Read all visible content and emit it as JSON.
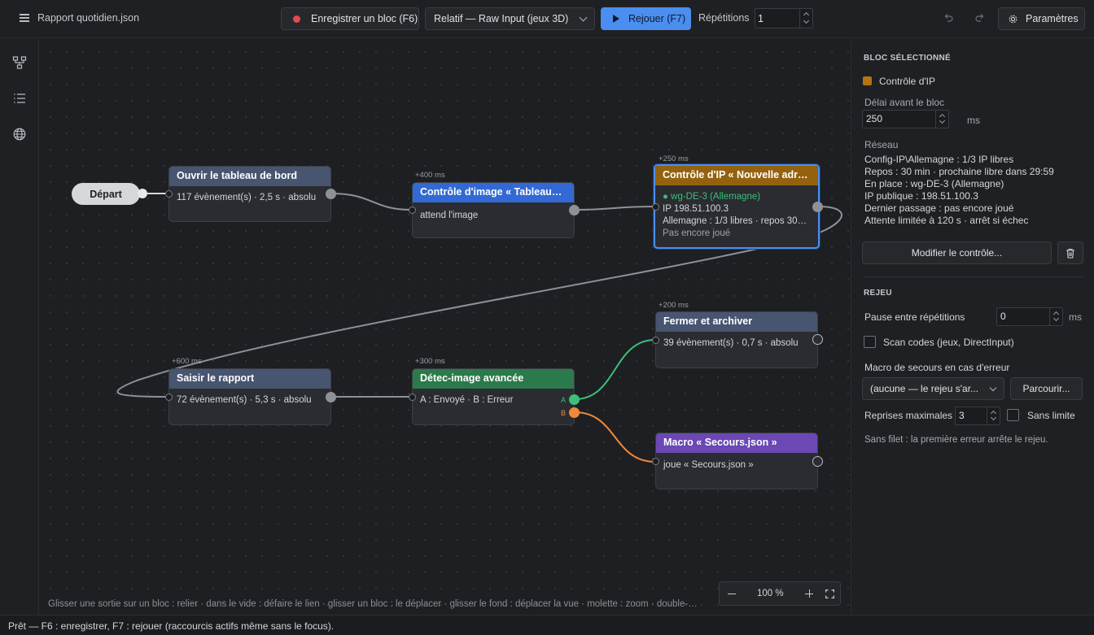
{
  "topbar": {
    "file_title": "Rapport quotidien.json",
    "record_label": "Enregistrer un bloc (F6)",
    "mode_value": "Relatif — Raw Input (jeux 3D)",
    "replay_label": "Rejouer (F7)",
    "repetitions_label": "Répétitions",
    "repetitions_value": "1",
    "settings_label": "Paramètres"
  },
  "canvas": {
    "start_label": "Départ",
    "nodes": {
      "open_dashboard": {
        "title": "Ouvrir le tableau de bord",
        "line1": "117 évènement(s) · 2,5 s · absolu"
      },
      "image_check": {
        "delay": "+400 ms",
        "title": "Contrôle d'image « Tableau…",
        "line1": "attend l'image"
      },
      "ip_check": {
        "delay": "+250 ms",
        "title": "Contrôle d'IP « Nouvelle adr…",
        "line1": "● wg-DE-3 (Allemagne)",
        "line2": "IP 198.51.100.3",
        "line3": "Allemagne : 1/3 libres · repos 30…",
        "line4": "Pas encore joué"
      },
      "close_archive": {
        "delay": "+200 ms",
        "title": "Fermer et archiver",
        "line1": "39 évènement(s) · 0,7 s · absolu"
      },
      "enter_report": {
        "delay": "+600 ms",
        "title": "Saisir le rapport",
        "line1": "72 évènement(s) · 5,3 s · absolu"
      },
      "advanced_detect": {
        "delay": "+300 ms",
        "title": "Détec-image avancée",
        "line1": "A : Envoyé · B : Erreur",
        "port_a": "A",
        "port_b": "B"
      },
      "fallback_macro": {
        "title": "Macro « Secours.json »",
        "line1": "joue « Secours.json »"
      }
    },
    "hint": "Glisser une sortie sur un bloc : relier · dans le vide : défaire le lien · glisser un bloc : le déplacer · glisser le fond : déplacer la vue · molette : zoom · double-…",
    "zoom_value": "100 %"
  },
  "panel": {
    "selected_section": "BLOC SÉLECTIONNÉ",
    "block_name": "Contrôle d'IP",
    "block_color": "#b37414",
    "delay_label": "Délai avant le bloc",
    "delay_value": "250",
    "delay_unit": "ms",
    "network_title": "Réseau",
    "network_lines": [
      "Config-IP\\Allemagne : 1/3 IP libres",
      "Repos : 30 min · prochaine libre dans 29:59",
      "En place : wg-DE-3 (Allemagne)",
      "IP publique : 198.51.100.3",
      "Dernier passage : pas encore joué",
      "Attente limitée à 120 s · arrêt si échec"
    ],
    "edit_button": "Modifier le contrôle...",
    "replay_section": "REJEU",
    "pause_label": "Pause entre répétitions",
    "pause_value": "0",
    "pause_unit": "ms",
    "scan_codes_label": "Scan codes (jeux, DirectInput)",
    "fallback_label": "Macro de secours en cas d'erreur",
    "fallback_value": "(aucune — le rejeu s'ar...",
    "browse_button": "Parcourir...",
    "max_retries_label": "Reprises maximales",
    "max_retries_value": "3",
    "unlimited_label": "Sans limite",
    "note": "Sans filet : la première erreur arrête le rejeu."
  },
  "statusbar": {
    "text": "Prêt — F6 : enregistrer, F7 : rejouer (raccourcis actifs même sans le focus)."
  },
  "icons": {
    "menu": "hamburger-icon",
    "record": "record-dot-icon",
    "play": "play-icon",
    "undo": "undo-icon",
    "redo": "redo-icon",
    "settings": "gear-icon",
    "graph": "node-graph-icon",
    "list": "list-icon",
    "globe": "globe-icon",
    "trash": "trash-icon",
    "fit": "fit-screen-icon"
  }
}
